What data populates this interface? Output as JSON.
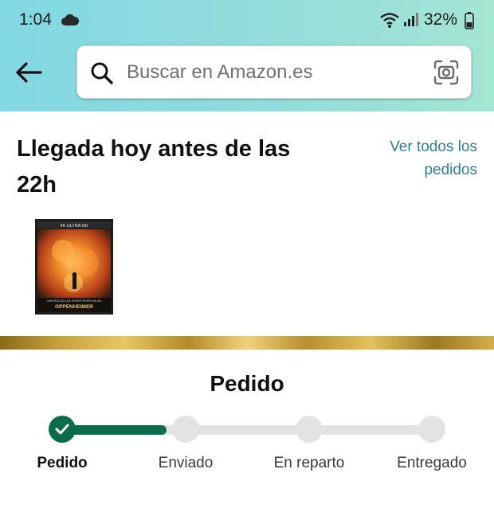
{
  "status_bar": {
    "time": "1:04",
    "battery": "32%",
    "icons": [
      "cloud-icon",
      "wifi-icon",
      "signal-icon",
      "battery-icon"
    ]
  },
  "header": {
    "back_icon": "arrow-left-icon",
    "search_placeholder": "Buscar en Amazon.es",
    "search_icon": "magnifier-icon",
    "camera_icon": "camera-scan-icon"
  },
  "order": {
    "arrival_title": "Llegada hoy antes de las 22h",
    "view_all_link": "Ver todos los pedidos",
    "product_cover_text": {
      "badge": "4K ULTRA HD",
      "director": "UNA PELÍCULA DE CHRISTOPHER NOLAN",
      "title": "OPPENHEIMER"
    }
  },
  "tracking": {
    "heading": "Pedido",
    "progress": 0.25,
    "steps": [
      {
        "label": "Pedido",
        "state": "done"
      },
      {
        "label": "Enviado",
        "state": "pending"
      },
      {
        "label": "En reparto",
        "state": "pending"
      },
      {
        "label": "Entregado",
        "state": "pending"
      }
    ]
  },
  "colors": {
    "header_gradient_start": "#82d8e3",
    "header_gradient_end": "#a5e5d3",
    "link": "#2f7e8a",
    "progress_done": "#0a6b4d",
    "progress_pending": "#e3e3e3"
  }
}
